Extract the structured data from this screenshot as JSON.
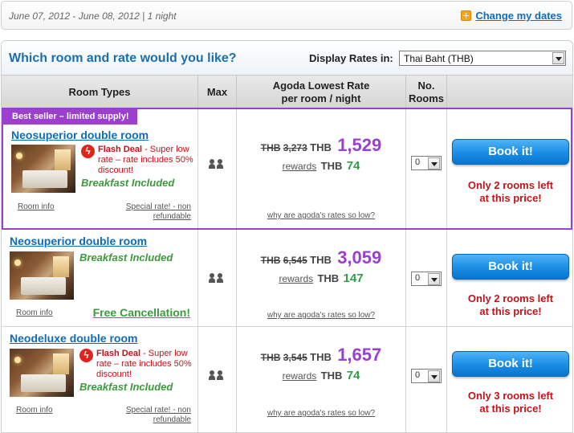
{
  "datebar": {
    "dates": "June 07, 2012 - June 08, 2012 | 1 night",
    "change_label": "Change my dates"
  },
  "panel": {
    "question": "Which room and rate would you like?",
    "rates_label": "Display Rates in:",
    "currency_selected": "Thai Baht (THB)"
  },
  "columns": {
    "room_types": "Room Types",
    "max": "Max",
    "rate_line1": "Agoda Lowest Rate",
    "rate_line2": "per room / night",
    "rooms_line1": "No.",
    "rooms_line2": "Rooms"
  },
  "rooms": [
    {
      "badge": "Best seller – limited supply!",
      "name": "Neosuperior double room",
      "flash_title": "Flash Deal",
      "flash_text": " - Super low rate – rate includes 50% discount!",
      "breakfast": "Breakfast Included",
      "room_info": "Room info",
      "special": "Special rate! - non refundable",
      "old_currency": "THB",
      "old_price": "3,273",
      "currency": "THB",
      "price": "1,529",
      "rewards_label": "rewards",
      "rewards_currency": "THB",
      "rewards_points": "74",
      "why": "why are agoda's rates so low?",
      "qty": "0",
      "book": "Book it!",
      "left_line1": "Only 2 rooms left",
      "left_line2": "at this price!"
    },
    {
      "name": "Neosuperior double room",
      "breakfast": "Breakfast Included",
      "room_info": "Room info",
      "free_cancel": "Free Cancellation!",
      "old_currency": "THB",
      "old_price": "6,545",
      "currency": "THB",
      "price": "3,059",
      "rewards_label": "rewards",
      "rewards_currency": "THB",
      "rewards_points": "147",
      "why": "why are agoda's rates so low?",
      "qty": "0",
      "book": "Book it!",
      "left_line1": "Only 2 rooms left",
      "left_line2": "at this price!"
    },
    {
      "name": "Neodeluxe double room",
      "flash_title": "Flash Deal",
      "flash_text": " - Super low rate – rate includes 50% discount!",
      "breakfast": "Breakfast Included",
      "room_info": "Room info",
      "special": "Special rate! - non refundable",
      "old_currency": "THB",
      "old_price": "3,545",
      "currency": "THB",
      "price": "1,657",
      "rewards_label": "rewards",
      "rewards_currency": "THB",
      "rewards_points": "74",
      "why": "why are agoda's rates so low?",
      "qty": "0",
      "book": "Book it!",
      "left_line1": "Only 3 rooms left",
      "left_line2": "at this price!"
    }
  ],
  "colors": {
    "accent_blue": "#0f6bb8",
    "featured_purple": "#9b3fcf",
    "deal_red": "#c4121b",
    "green": "#3b9b3b"
  }
}
